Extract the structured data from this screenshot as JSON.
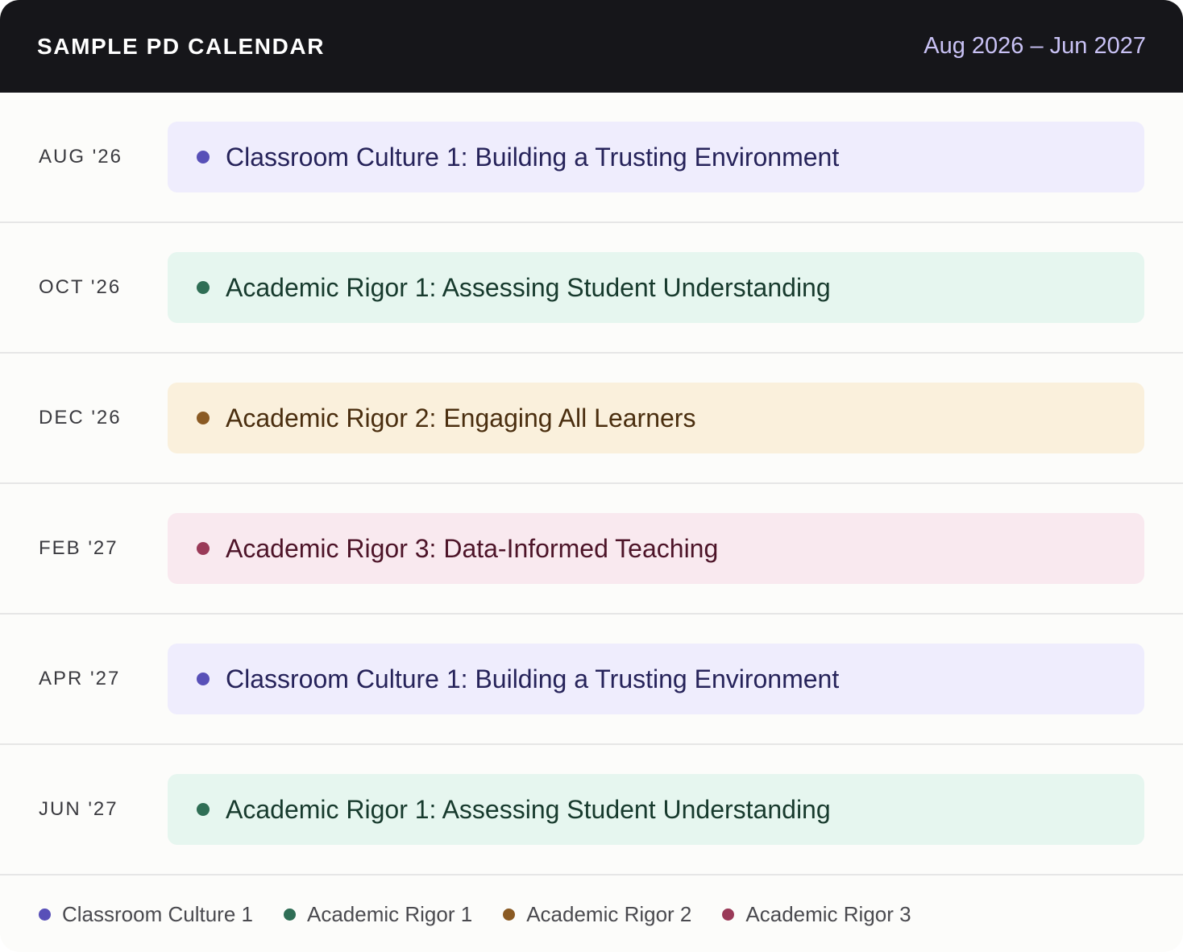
{
  "header": {
    "title": "SAMPLE PD CALENDAR",
    "range": "Aug 2026 – Jun 2027",
    "range_color": "#c9c2f5"
  },
  "themes": {
    "culture1": {
      "dot": "#5850b8",
      "bg": "#efedfd",
      "text": "#26235a"
    },
    "rigor1": {
      "dot": "#2f6e55",
      "bg": "#e6f6ef",
      "text": "#173a2d"
    },
    "rigor2": {
      "dot": "#8a5a23",
      "bg": "#faf0dc",
      "text": "#4a2e0f"
    },
    "rigor3": {
      "dot": "#9a3a58",
      "bg": "#f9e9ef",
      "text": "#4d1428"
    }
  },
  "rows": [
    {
      "month": "AUG '26",
      "session": "Classroom Culture 1: Building a Trusting Environment",
      "theme": "culture1"
    },
    {
      "month": "OCT '26",
      "session": "Academic Rigor 1: Assessing Student Understanding",
      "theme": "rigor1"
    },
    {
      "month": "DEC '26",
      "session": "Academic Rigor 2: Engaging All Learners",
      "theme": "rigor2"
    },
    {
      "month": "FEB '27",
      "session": "Academic Rigor 3: Data-Informed Teaching",
      "theme": "rigor3"
    },
    {
      "month": "APR '27",
      "session": "Classroom Culture 1: Building a Trusting Environment",
      "theme": "culture1"
    },
    {
      "month": "JUN '27",
      "session": "Academic Rigor 1: Assessing Student Understanding",
      "theme": "rigor1"
    }
  ],
  "legend": [
    {
      "label": "Classroom Culture 1",
      "theme": "culture1"
    },
    {
      "label": "Academic Rigor 1",
      "theme": "rigor1"
    },
    {
      "label": "Academic Rigor 2",
      "theme": "rigor2"
    },
    {
      "label": "Academic Rigor 3",
      "theme": "rigor3"
    }
  ]
}
